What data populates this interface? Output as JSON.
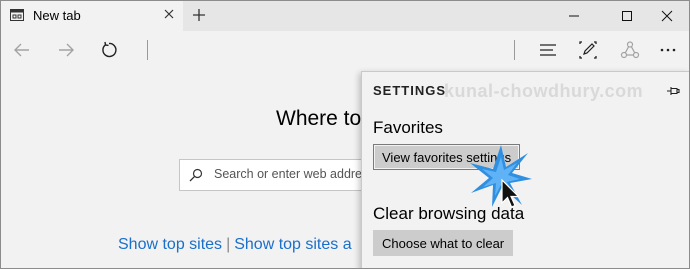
{
  "tab": {
    "title": "New tab"
  },
  "window_controls": [
    "minimize-icon",
    "maximize-icon",
    "close-icon"
  ],
  "navbar": {
    "icons": [
      "back-arrow-icon",
      "forward-arrow-icon",
      "refresh-icon",
      "hub-icon",
      "web-note-icon",
      "share-icon",
      "more-icon"
    ]
  },
  "page": {
    "heading": "Where to",
    "search_placeholder": "Search or enter web address",
    "links": {
      "show_top_sites": "Show top sites",
      "separator": "|",
      "show_top_sites_and": "Show top sites a"
    }
  },
  "settings": {
    "title": "SETTINGS",
    "watermark": "kunal-chowdhury.com",
    "favorites": {
      "heading": "Favorites",
      "button": "View favorites settings"
    },
    "clear_data": {
      "heading": "Clear browsing data",
      "button": "Choose what to clear"
    }
  },
  "colors": {
    "link": "#1a6fc9",
    "button_bg": "#cccccc",
    "click_burst": "#2f8fe0"
  }
}
